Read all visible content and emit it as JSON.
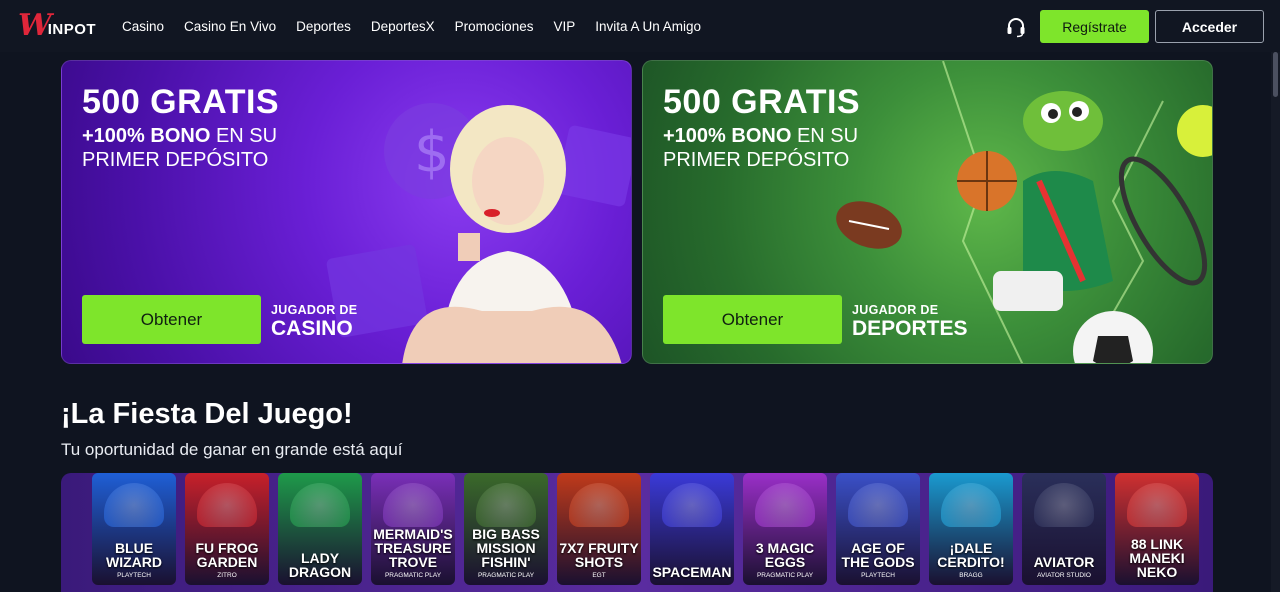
{
  "header": {
    "logo_text": "WINPOT",
    "nav": [
      "Casino",
      "Casino En Vivo",
      "Deportes",
      "DeportesX",
      "Promociones",
      "VIP",
      "Invita A Un Amigo"
    ],
    "register_label": "Regístrate",
    "login_label": "Acceder"
  },
  "promos": [
    {
      "headline": "500 GRATIS",
      "bonus_bold": "+100% BONO",
      "bonus_rest": " EN SU",
      "line2": "PRIMER DEPÓSITO",
      "button": "Obtener",
      "who_small": "JUGADOR DE",
      "who_big": "CASINO"
    },
    {
      "headline": "500 GRATIS",
      "bonus_bold": "+100% BONO",
      "bonus_rest": " EN SU",
      "line2": "PRIMER DEPÓSITO",
      "button": "Obtener",
      "who_small": "JUGADOR DE",
      "who_big": "DEPORTES"
    }
  ],
  "section": {
    "title": "¡La Fiesta Del Juego!",
    "subtitle": "Tu oportunidad de ganar en grande está aquí"
  },
  "games": [
    {
      "name": "BLUE WIZARD",
      "provider": "PLAYTECH",
      "color": "#1f5fd6"
    },
    {
      "name": "FU FROG GARDEN",
      "provider": "ZITRO",
      "color": "#c8202a"
    },
    {
      "name": "LADY DRAGON",
      "provider": "",
      "color": "#1e9a4a"
    },
    {
      "name": "MERMAID'S TREASURE TROVE",
      "provider": "PRAGMATIC PLAY",
      "color": "#7a2fb8"
    },
    {
      "name": "BIG BASS MISSION FISHIN'",
      "provider": "PRAGMATIC PLAY",
      "color": "#3a6a2a"
    },
    {
      "name": "7X7 FRUITY SHOTS",
      "provider": "EGT",
      "color": "#c03a1a"
    },
    {
      "name": "SPACEMAN",
      "provider": "",
      "color": "#3a3ad8"
    },
    {
      "name": "3 MAGIC EGGS",
      "provider": "PRAGMATIC PLAY",
      "color": "#9a2fc8"
    },
    {
      "name": "AGE OF THE GODS",
      "provider": "PLAYTECH",
      "color": "#3a50c8"
    },
    {
      "name": "¡DALE CERDITO!",
      "provider": "BRAGG",
      "color": "#1a9ad0"
    },
    {
      "name": "AVIATOR",
      "provider": "AVIATOR STUDIO",
      "color": "#2a2f5a"
    },
    {
      "name": "88 LINK MANEKI NEKO",
      "provider": "",
      "color": "#d03030"
    }
  ]
}
